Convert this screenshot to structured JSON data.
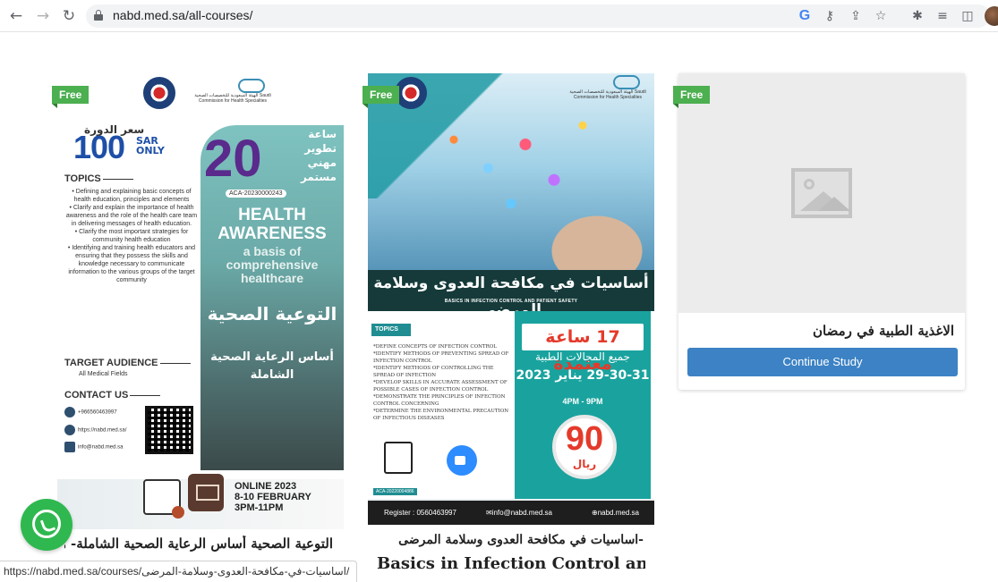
{
  "browser": {
    "url": "nabd.med.sa/all-courses/",
    "status_url": "https://nabd.med.sa/courses/اساسيات-في-مكافحة-العدوى-وسلامة-المرضى/"
  },
  "badge_label": "Free",
  "course1": {
    "price_label": "سعر الدورة",
    "price": "100",
    "price_unit": "SAR ONLY",
    "topics_heading": "TOPICS",
    "topics": [
      "Defining and explaining basic concepts of health education, principles and elements",
      "Clarify and explain the importance of health awareness and the role of the health care team in delivering messages of health education.",
      "Clarify the most important strategies for community health education",
      "Identifying and training health educators and ensuring that they possess the skills and knowledge necessary to communicate information to the various groups of the target community"
    ],
    "audience_heading": "TARGET AUDIENCE",
    "audience": "All Medical Fields",
    "contact_heading": "CONTACT US",
    "phone": "+966560463997",
    "website": "https://nabd.med.sa/",
    "email": "info@nabd.med.sa",
    "hours": "20",
    "hours_label": "ساعة تطوير مهني مستمر",
    "aca_code": "ACA-20230000243",
    "title_en_1": "HEALTH",
    "title_en_2": "AWARENESS",
    "subtitle_en": "a basis of comprehensive healthcare",
    "title_ar": "التوعية الصحية",
    "subtitle_ar": "أساس الرعاية الصحية الشاملة",
    "online": "ONLINE 2023",
    "dates": "8-10 FEBRUARY",
    "time": "3PM-11PM",
    "card_title": "التوعية الصحية أساس الرعاية الصحية الشاملة- هي",
    "scfhs_text": "الهيئة السعودية للتخصصات الصحية Saudi Commission for Health Specialties"
  },
  "course2": {
    "banner_title": "أساسيات في مكافحة العدوى وسلامة المرضى",
    "banner_en": "BASICS IN INFECTION CONTROL AND PATIENT SAFETY",
    "topics_tag": "TOPICS",
    "topics": [
      "*DEFINE CONCEPTS OF INFECTION CONTROL",
      "*IDENTIFY METHODS OF PREVENTING SPREAD OF INFECTION CONTROL",
      "*IDENTIFY METHODS OF CONTROLLING THE SPREAD OF INFECTION",
      "*DEVELOP SKILLS IN ACCURATE ASSESSMENT OF POSSIBLE CASES OF INFECTION CONTROL",
      "*DEMONSTRATE THE PRINCIPLES OF INFECTION CONTROL CONCERNING",
      "*DETERMINE THE ENVIRONMENTAL PRECAUTION OF INFECTIOUS DISEASES"
    ],
    "hours": "17 ساعة معتمدة",
    "fields": "جميع المجالات الطبية",
    "dates": "29-30-31 يناير 2023",
    "time": "4PM - 9PM",
    "price": "90",
    "price_unit": "ريال",
    "aca_code": "ACA-20220004886",
    "register": "Register : 0560463997",
    "email": "info@nabd.med.sa",
    "website": "nabd.med.sa",
    "card_title_ar": "-اساسيات في مكافحة العدوى وسلامة المرضى",
    "card_title_en": "Basics in Infection Control and",
    "scfhs_text": "الهيئة السعودية للتخصصات الصحية Saudi Commission for Health Specialties"
  },
  "course3": {
    "card_title": "الاغذية الطبية في رمضان",
    "button_label": "Continue Study"
  },
  "colors": {
    "accent": "#3c82c4",
    "badge": "#4caf50",
    "whatsapp": "#2fb84f"
  }
}
